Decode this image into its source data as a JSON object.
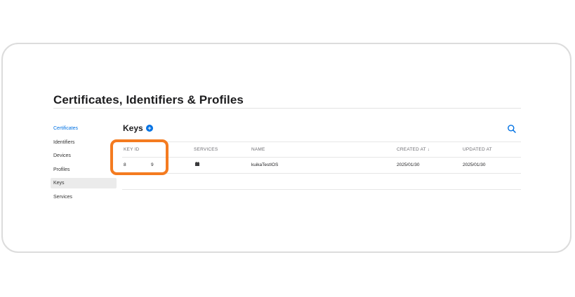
{
  "page": {
    "title": "Certificates, Identifiers & Profiles"
  },
  "sidebar": {
    "items": [
      {
        "label": "Certificates"
      },
      {
        "label": "Identifiers"
      },
      {
        "label": "Devices"
      },
      {
        "label": "Profiles"
      },
      {
        "label": "Keys"
      },
      {
        "label": "Services"
      }
    ]
  },
  "keys": {
    "title": "Keys",
    "add_icon": "plus-circle-icon",
    "search_icon": "search-icon",
    "columns": {
      "key_id": "KEY ID",
      "services": "SERVICES",
      "name": "NAME",
      "created_at": "CREATED AT ↓",
      "updated_at": "UPDATED AT"
    },
    "rows": [
      {
        "key_id_start": "8",
        "key_id_end": "9",
        "service_icon": "apns-icon",
        "name": "kuikaTestIOS",
        "created_at": "2025/01/30",
        "updated_at": "2025/01/30"
      }
    ]
  },
  "colors": {
    "accent": "#0071e3",
    "highlight": "#f47b20",
    "selected_bg": "#ebebeb"
  }
}
